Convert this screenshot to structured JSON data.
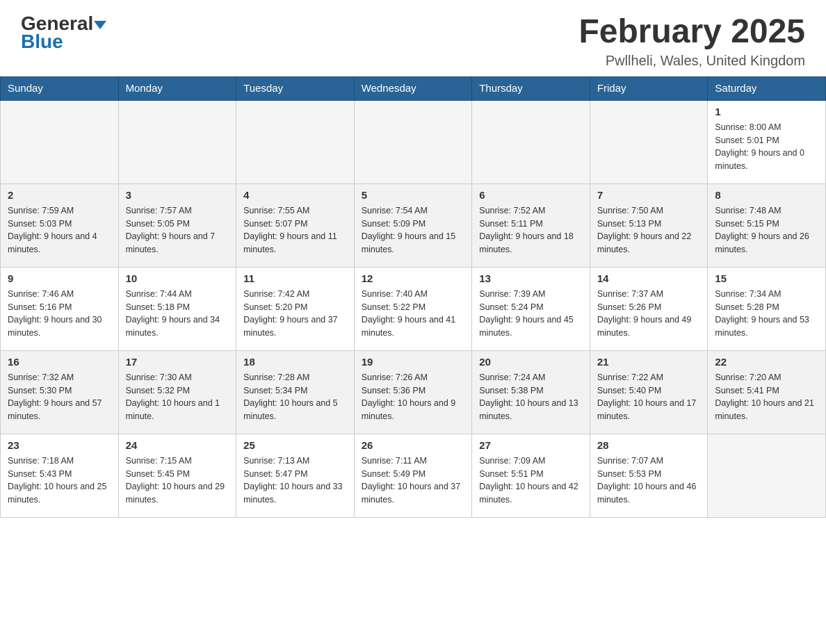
{
  "header": {
    "logo_line1": "General",
    "logo_line2": "Blue",
    "month_title": "February 2025",
    "location": "Pwllheli, Wales, United Kingdom"
  },
  "days_of_week": [
    "Sunday",
    "Monday",
    "Tuesday",
    "Wednesday",
    "Thursday",
    "Friday",
    "Saturday"
  ],
  "weeks": [
    [
      {
        "day": "",
        "info": ""
      },
      {
        "day": "",
        "info": ""
      },
      {
        "day": "",
        "info": ""
      },
      {
        "day": "",
        "info": ""
      },
      {
        "day": "",
        "info": ""
      },
      {
        "day": "",
        "info": ""
      },
      {
        "day": "1",
        "info": "Sunrise: 8:00 AM\nSunset: 5:01 PM\nDaylight: 9 hours and 0 minutes."
      }
    ],
    [
      {
        "day": "2",
        "info": "Sunrise: 7:59 AM\nSunset: 5:03 PM\nDaylight: 9 hours and 4 minutes."
      },
      {
        "day": "3",
        "info": "Sunrise: 7:57 AM\nSunset: 5:05 PM\nDaylight: 9 hours and 7 minutes."
      },
      {
        "day": "4",
        "info": "Sunrise: 7:55 AM\nSunset: 5:07 PM\nDaylight: 9 hours and 11 minutes."
      },
      {
        "day": "5",
        "info": "Sunrise: 7:54 AM\nSunset: 5:09 PM\nDaylight: 9 hours and 15 minutes."
      },
      {
        "day": "6",
        "info": "Sunrise: 7:52 AM\nSunset: 5:11 PM\nDaylight: 9 hours and 18 minutes."
      },
      {
        "day": "7",
        "info": "Sunrise: 7:50 AM\nSunset: 5:13 PM\nDaylight: 9 hours and 22 minutes."
      },
      {
        "day": "8",
        "info": "Sunrise: 7:48 AM\nSunset: 5:15 PM\nDaylight: 9 hours and 26 minutes."
      }
    ],
    [
      {
        "day": "9",
        "info": "Sunrise: 7:46 AM\nSunset: 5:16 PM\nDaylight: 9 hours and 30 minutes."
      },
      {
        "day": "10",
        "info": "Sunrise: 7:44 AM\nSunset: 5:18 PM\nDaylight: 9 hours and 34 minutes."
      },
      {
        "day": "11",
        "info": "Sunrise: 7:42 AM\nSunset: 5:20 PM\nDaylight: 9 hours and 37 minutes."
      },
      {
        "day": "12",
        "info": "Sunrise: 7:40 AM\nSunset: 5:22 PM\nDaylight: 9 hours and 41 minutes."
      },
      {
        "day": "13",
        "info": "Sunrise: 7:39 AM\nSunset: 5:24 PM\nDaylight: 9 hours and 45 minutes."
      },
      {
        "day": "14",
        "info": "Sunrise: 7:37 AM\nSunset: 5:26 PM\nDaylight: 9 hours and 49 minutes."
      },
      {
        "day": "15",
        "info": "Sunrise: 7:34 AM\nSunset: 5:28 PM\nDaylight: 9 hours and 53 minutes."
      }
    ],
    [
      {
        "day": "16",
        "info": "Sunrise: 7:32 AM\nSunset: 5:30 PM\nDaylight: 9 hours and 57 minutes."
      },
      {
        "day": "17",
        "info": "Sunrise: 7:30 AM\nSunset: 5:32 PM\nDaylight: 10 hours and 1 minute."
      },
      {
        "day": "18",
        "info": "Sunrise: 7:28 AM\nSunset: 5:34 PM\nDaylight: 10 hours and 5 minutes."
      },
      {
        "day": "19",
        "info": "Sunrise: 7:26 AM\nSunset: 5:36 PM\nDaylight: 10 hours and 9 minutes."
      },
      {
        "day": "20",
        "info": "Sunrise: 7:24 AM\nSunset: 5:38 PM\nDaylight: 10 hours and 13 minutes."
      },
      {
        "day": "21",
        "info": "Sunrise: 7:22 AM\nSunset: 5:40 PM\nDaylight: 10 hours and 17 minutes."
      },
      {
        "day": "22",
        "info": "Sunrise: 7:20 AM\nSunset: 5:41 PM\nDaylight: 10 hours and 21 minutes."
      }
    ],
    [
      {
        "day": "23",
        "info": "Sunrise: 7:18 AM\nSunset: 5:43 PM\nDaylight: 10 hours and 25 minutes."
      },
      {
        "day": "24",
        "info": "Sunrise: 7:15 AM\nSunset: 5:45 PM\nDaylight: 10 hours and 29 minutes."
      },
      {
        "day": "25",
        "info": "Sunrise: 7:13 AM\nSunset: 5:47 PM\nDaylight: 10 hours and 33 minutes."
      },
      {
        "day": "26",
        "info": "Sunrise: 7:11 AM\nSunset: 5:49 PM\nDaylight: 10 hours and 37 minutes."
      },
      {
        "day": "27",
        "info": "Sunrise: 7:09 AM\nSunset: 5:51 PM\nDaylight: 10 hours and 42 minutes."
      },
      {
        "day": "28",
        "info": "Sunrise: 7:07 AM\nSunset: 5:53 PM\nDaylight: 10 hours and 46 minutes."
      },
      {
        "day": "",
        "info": ""
      }
    ]
  ]
}
